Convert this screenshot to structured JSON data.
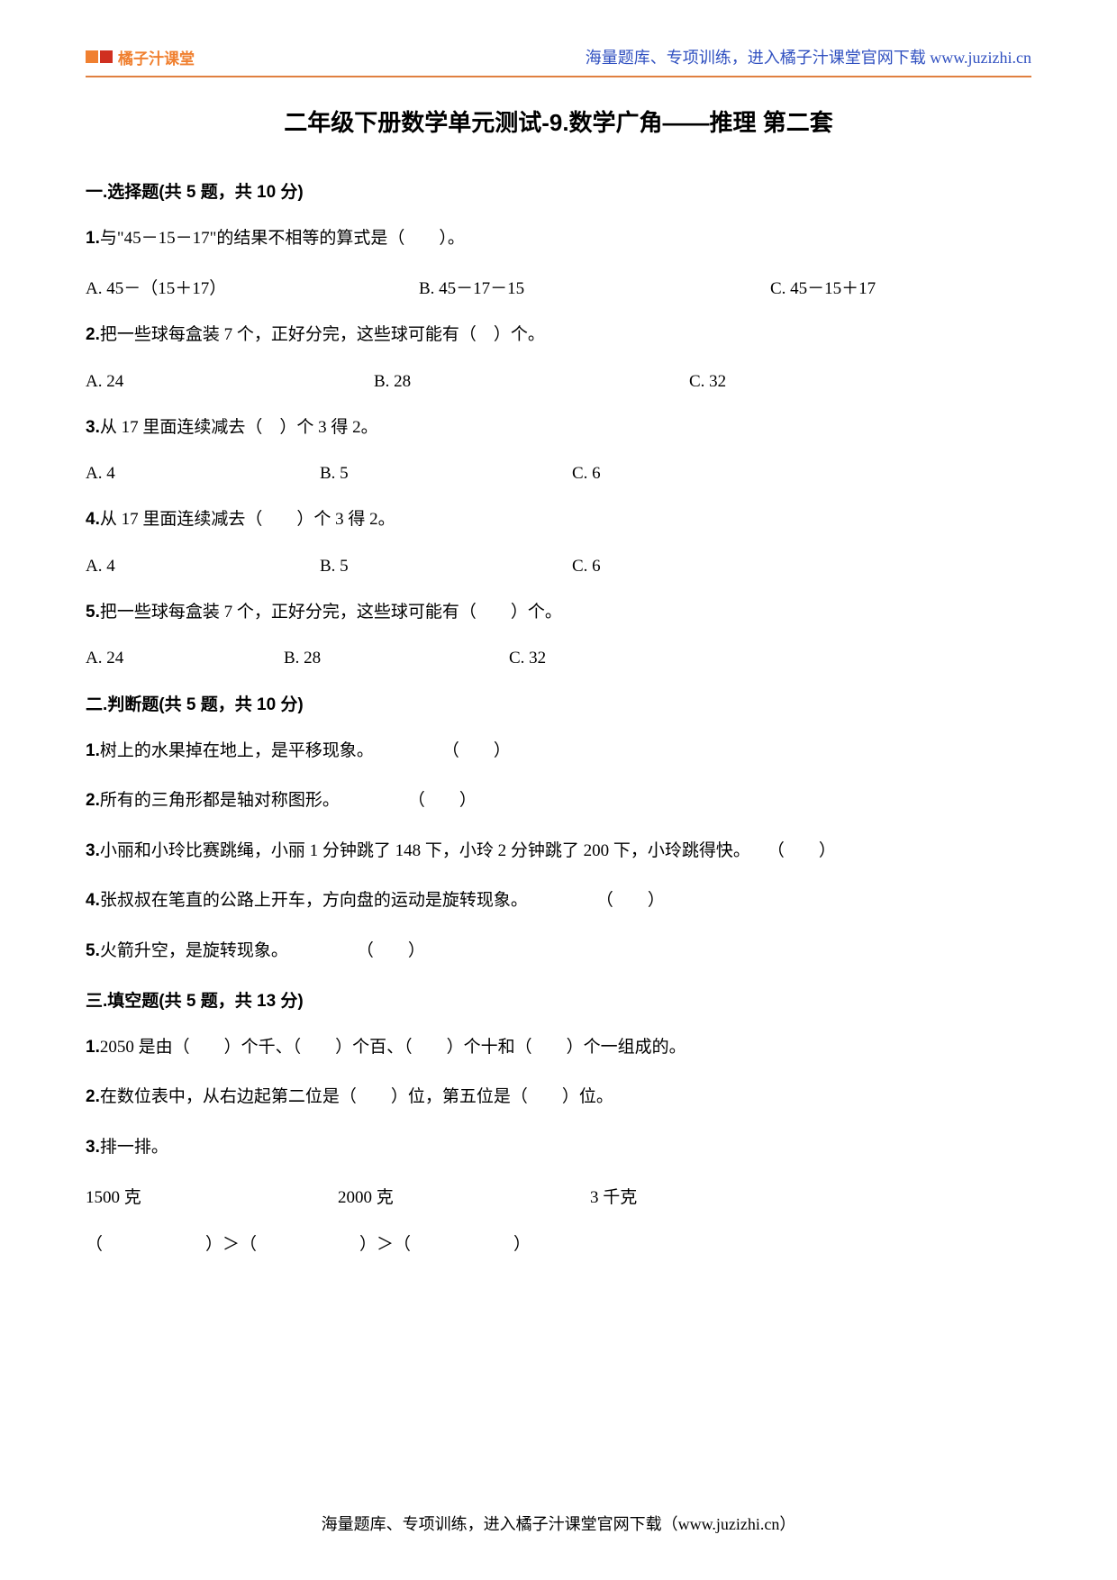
{
  "header": {
    "logo_text": "橘子汁课堂",
    "right_text": "海量题库、专项训练，进入橘子汁课堂官网下载 www.juzizhi.cn"
  },
  "title": "二年级下册数学单元测试-9.数学广角——推理  第二套",
  "section1": {
    "header": "一.选择题(共 5 题，共 10 分)",
    "q1": {
      "num": "1.",
      "text": "与\"45－15－17\"的结果不相等的算式是（　　）。",
      "opts": [
        "A. 45－（15＋17）",
        "B. 45－17－15",
        "C. 45－15＋17"
      ]
    },
    "q2": {
      "num": "2.",
      "text": "把一些球每盒装 7 个，正好分完，这些球可能有（　）个。",
      "opts": [
        "A. 24",
        "B.  28",
        "C. 32"
      ]
    },
    "q3": {
      "num": "3.",
      "text": "从 17 里面连续减去（　）个 3 得 2。",
      "opts": [
        "A. 4",
        "B. 5",
        "C. 6"
      ]
    },
    "q4": {
      "num": "4.",
      "text": "从 17 里面连续减去（　　）个 3 得 2。",
      "opts": [
        "A.  4",
        "B.  5",
        "C.  6"
      ]
    },
    "q5": {
      "num": "5.",
      "text": "把一些球每盒装 7 个，正好分完，这些球可能有（　　）个。",
      "opts": [
        "A.  24",
        "B.  28",
        "C.  32"
      ]
    }
  },
  "section2": {
    "header": "二.判断题(共 5 题，共 10 分)",
    "q1": {
      "num": "1.",
      "text": "树上的水果掉在地上，是平移现象。　　　　　（　　）"
    },
    "q2": {
      "num": "2.",
      "text": "所有的三角形都是轴对称图形。　　　　　（　　）"
    },
    "q3": {
      "num": "3.",
      "text": "小丽和小玲比赛跳绳，小丽 1 分钟跳了 148 下，小玲 2 分钟跳了 200 下，小玲跳得快。　　（　　）"
    },
    "q4": {
      "num": "4.",
      "text": "张叔叔在笔直的公路上开车，方向盘的运动是旋转现象。　　　　　（　　）"
    },
    "q5": {
      "num": "5.",
      "text": "火箭升空，是旋转现象。　　　　　（　　）"
    }
  },
  "section3": {
    "header": "三.填空题(共 5 题，共 13 分)",
    "q1": {
      "num": "1.",
      "text": "2050 是由（　　）个千、（　　）个百、（　　）个十和（　　）个一组成的。"
    },
    "q2": {
      "num": "2.",
      "text": "在数位表中，从右边起第二位是（　　）位，第五位是（　　）位。"
    },
    "q3": {
      "num": "3.",
      "text": "排一排。",
      "values": [
        "1500 克",
        "2000 克",
        "3 千克"
      ],
      "answer": "（　　　　　　）＞（　　　　　　）＞（　　　　　　）"
    }
  },
  "footer": "海量题库、专项训练，进入橘子汁课堂官网下载（www.juzizhi.cn）"
}
